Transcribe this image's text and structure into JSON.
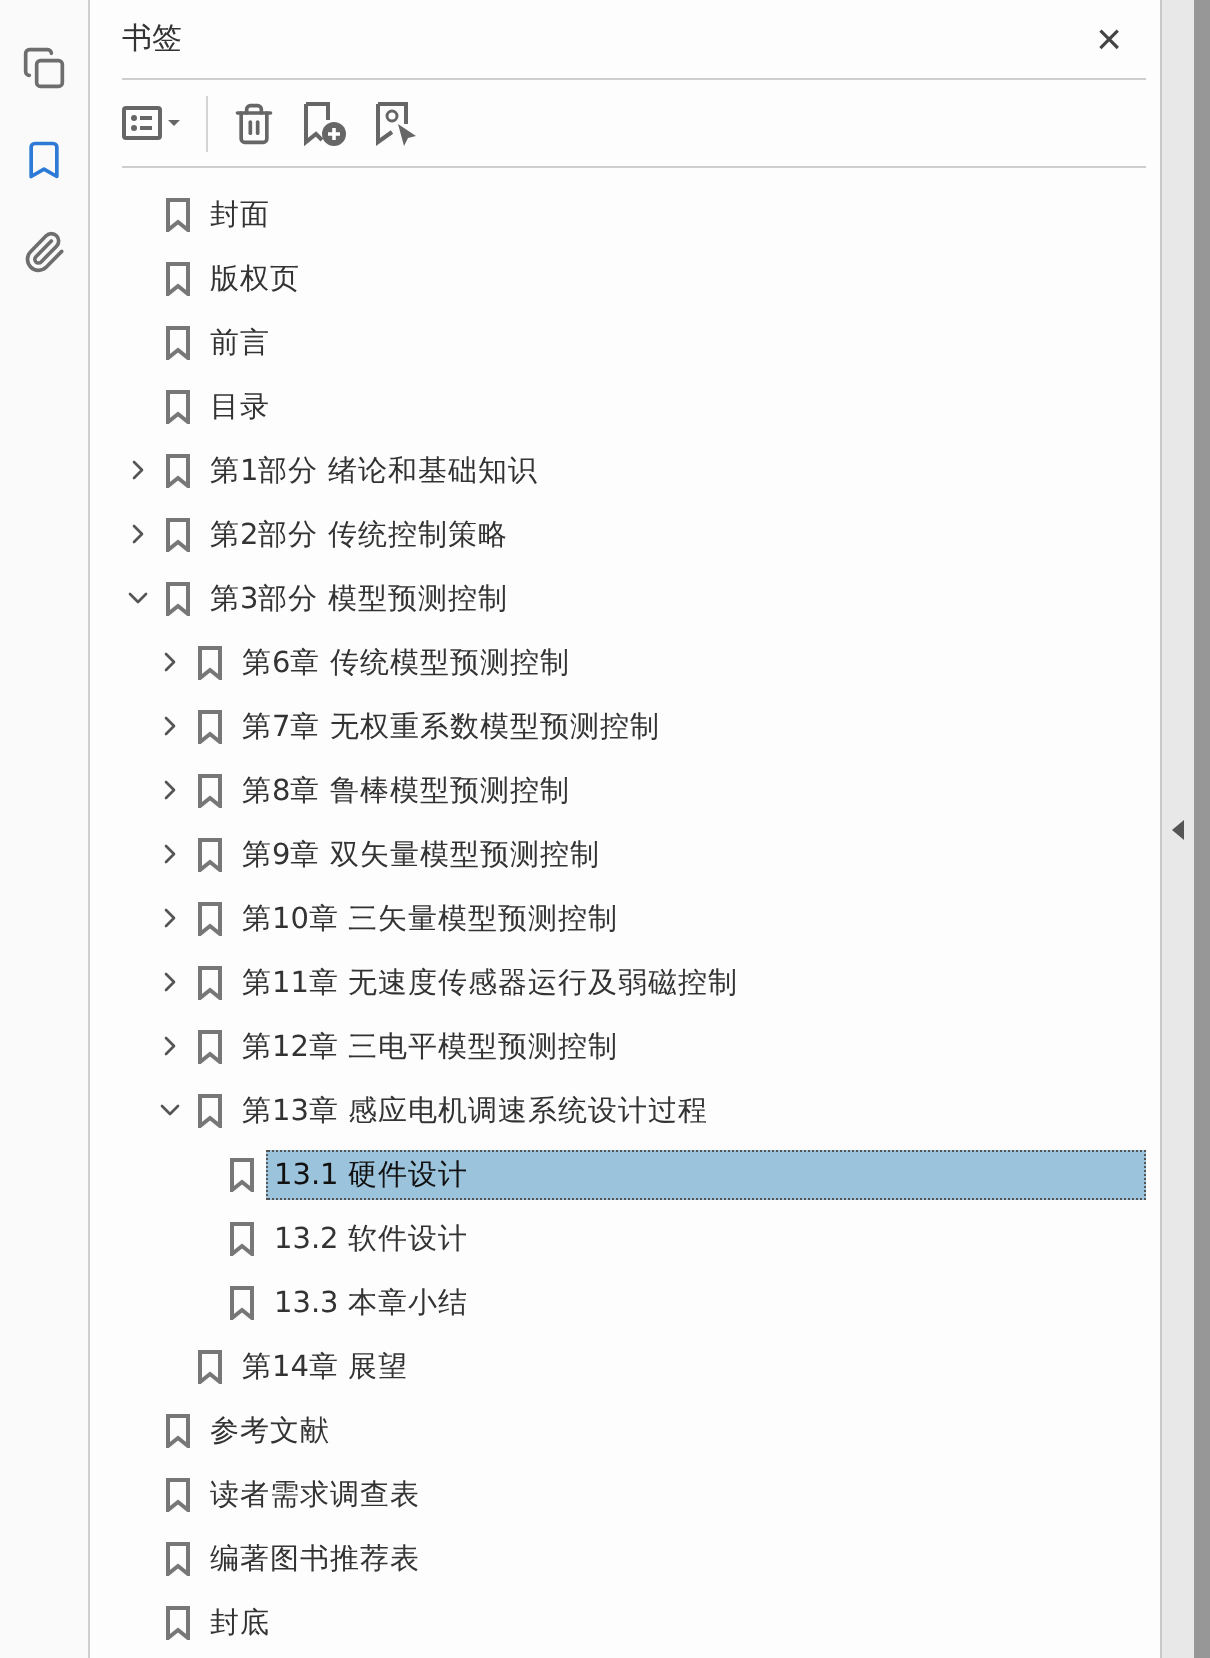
{
  "rail": [
    {
      "kind": "pages",
      "selected": false
    },
    {
      "kind": "bookmarks",
      "selected": true
    },
    {
      "kind": "attachments",
      "selected": false
    }
  ],
  "panel": {
    "title": "书签",
    "close": "×"
  },
  "tree": [
    {
      "label": "封面",
      "selected": false
    },
    {
      "label": "版权页",
      "selected": false
    },
    {
      "label": "前言",
      "selected": false
    },
    {
      "label": "目录",
      "selected": false
    },
    {
      "label": "第1部分 绪论和基础知识",
      "selected": false,
      "expanded": false
    },
    {
      "label": "第2部分 传统控制策略",
      "selected": false,
      "expanded": false
    },
    {
      "label": "第3部分 模型预测控制",
      "selected": false,
      "expanded": true,
      "children": [
        {
          "label": "第6章 传统模型预测控制",
          "selected": false,
          "expanded": false
        },
        {
          "label": "第7章 无权重系数模型预测控制",
          "selected": false,
          "expanded": false
        },
        {
          "label": "第8章 鲁棒模型预测控制",
          "selected": false,
          "expanded": false
        },
        {
          "label": "第9章 双矢量模型预测控制",
          "selected": false,
          "expanded": false
        },
        {
          "label": "第10章 三矢量模型预测控制",
          "selected": false,
          "expanded": false
        },
        {
          "label": "第11章 无速度传感器运行及弱磁控制",
          "selected": false,
          "expanded": false
        },
        {
          "label": "第12章 三电平模型预测控制",
          "selected": false,
          "expanded": false
        },
        {
          "label": "第13章 感应电机调速系统设计过程",
          "selected": false,
          "expanded": true,
          "children": [
            {
              "label": "13.1 硬件设计",
              "selected": true
            },
            {
              "label": "13.2 软件设计",
              "selected": false
            },
            {
              "label": "13.3 本章小结",
              "selected": false
            }
          ]
        },
        {
          "label": "第14章 展望",
          "selected": false
        }
      ]
    },
    {
      "label": "参考文献",
      "selected": false
    },
    {
      "label": "读者需求调查表",
      "selected": false
    },
    {
      "label": "编著图书推荐表",
      "selected": false
    },
    {
      "label": "封底",
      "selected": false
    }
  ]
}
